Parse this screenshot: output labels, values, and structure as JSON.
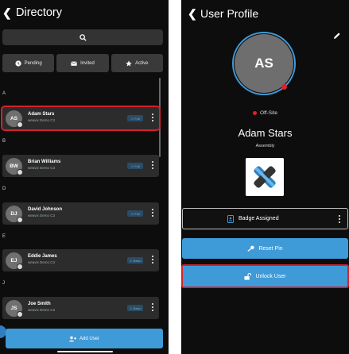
{
  "directory": {
    "title": "Directory",
    "filters": [
      {
        "label": "Pending",
        "icon": "clock-icon"
      },
      {
        "label": "Invited",
        "icon": "mail-icon"
      },
      {
        "label": "Active",
        "icon": "star-icon"
      }
    ],
    "sections": [
      {
        "letter": "A",
        "user": {
          "initials": "AS",
          "name": "Adam Stars",
          "sub": "weavix Demo C3",
          "badge": "Full"
        }
      },
      {
        "letter": "B",
        "user": {
          "initials": "BW",
          "name": "Brian Williams",
          "sub": "weavix Demo C3",
          "badge": "Full"
        }
      },
      {
        "letter": "D",
        "user": {
          "initials": "DJ",
          "name": "David Johnson",
          "sub": "weavix Demo C3",
          "badge": "Full"
        }
      },
      {
        "letter": "E",
        "user": {
          "initials": "EJ",
          "name": "Eddie James",
          "sub": "weavix Demo C3",
          "badge": "Basic"
        }
      },
      {
        "letter": "J",
        "user": {
          "initials": "JS",
          "name": "Joe Smith",
          "sub": "weavix Demo C3",
          "badge": "Basic"
        }
      }
    ],
    "add_user_label": "Add User"
  },
  "profile": {
    "title": "User Profile",
    "initials": "AS",
    "status": "Off-Site",
    "name": "Adam Stars",
    "department": "Assembly",
    "badge_label": "Badge Assigned",
    "reset_pin_label": "Reset Pin",
    "unlock_user_label": "Unlock User"
  },
  "colors": {
    "accent": "#3f9ad8",
    "highlight": "#d6202a",
    "offsite": "#e0202a"
  }
}
